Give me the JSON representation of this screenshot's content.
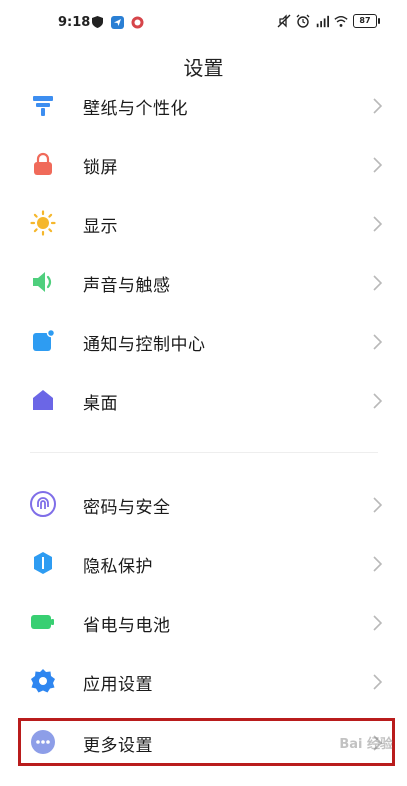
{
  "status_bar": {
    "time": "9:18",
    "battery": "87"
  },
  "header": {
    "title": "设置"
  },
  "settings": {
    "items": [
      {
        "label": "壁纸与个性化",
        "icon": "brush-icon",
        "color": "#3d8ef0"
      },
      {
        "label": "锁屏",
        "icon": "lock-icon",
        "color": "#f06a5a"
      },
      {
        "label": "显示",
        "icon": "sun-icon",
        "color": "#f5b72c"
      },
      {
        "label": "声音与触感",
        "icon": "speaker-icon",
        "color": "#4fcf7d"
      },
      {
        "label": "通知与控制中心",
        "icon": "notification-icon",
        "color": "#2e9cf2"
      },
      {
        "label": "桌面",
        "icon": "home-icon",
        "color": "#6b66e6"
      },
      {
        "label": "密码与安全",
        "icon": "fingerprint-icon",
        "color": "#7f6ee8"
      },
      {
        "label": "隐私保护",
        "icon": "privacy-shield-icon",
        "color": "#2e9cf2"
      },
      {
        "label": "省电与电池",
        "icon": "battery-icon",
        "color": "#38cf72"
      },
      {
        "label": "应用设置",
        "icon": "gear-icon",
        "color": "#2e86f0"
      },
      {
        "label": "更多设置",
        "icon": "more-dots-icon",
        "color": "#8d9ee8"
      }
    ]
  },
  "watermark": {
    "text": "Bai 经验"
  }
}
